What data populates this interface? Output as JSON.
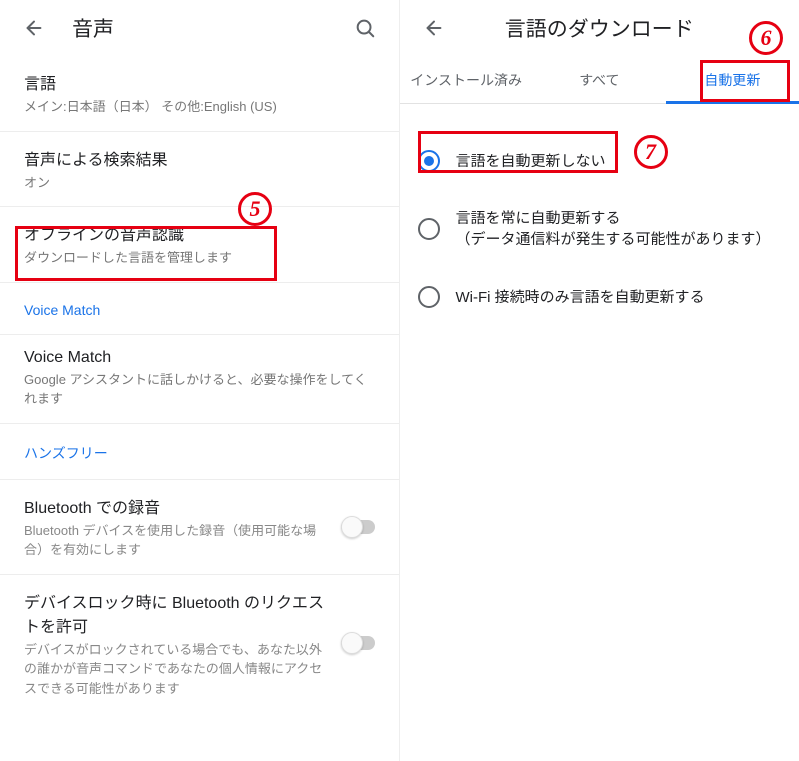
{
  "left": {
    "appbar": {
      "title": "音声"
    },
    "items": {
      "language": {
        "primary": "言語",
        "secondary": "メイン:日本語（日本） その他:English (US)"
      },
      "voiceSearch": {
        "primary": "音声による検索結果",
        "secondary": "オン"
      },
      "offline": {
        "primary": "オフラインの音声認識",
        "secondary": "ダウンロードした言語を管理します"
      },
      "voiceMatchSection": "Voice Match",
      "voiceMatch": {
        "primary": "Voice Match",
        "secondary": "Google アシスタントに話しかけると、必要な操作をしてくれます"
      },
      "handsfreeSection": "ハンズフリー",
      "btRecord": {
        "primary": "Bluetooth での録音",
        "secondary": "Bluetooth デバイスを使用した録音（使用可能な場合）を有効にします"
      },
      "btLock": {
        "primary": "デバイスロック時に Bluetooth のリクエストを許可",
        "secondary": "デバイスがロックされている場合でも、あなた以外の誰かが音声コマンドであなたの個人情報にアクセスできる可能性があります"
      }
    }
  },
  "right": {
    "appbar": {
      "title": "言語のダウンロード"
    },
    "tabs": {
      "installed": "インストール済み",
      "all": "すべて",
      "auto": "自動更新"
    },
    "radios": {
      "r1": "言語を自動更新しない",
      "r2": "言語を常に自動更新する\n（データ通信料が発生する可能性があります）",
      "r3": "Wi-Fi 接続時のみ言語を自動更新する"
    }
  },
  "annotations": {
    "a5": "5",
    "a6": "6",
    "a7": "7"
  }
}
